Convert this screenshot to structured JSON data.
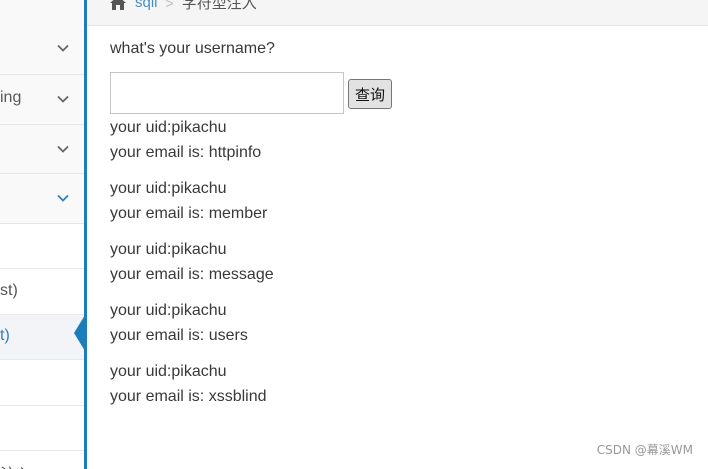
{
  "breadcrumb": {
    "link": "sqli",
    "current": "字符型注入"
  },
  "sidebar": {
    "items": [
      {
        "label": "",
        "expanded": false
      },
      {
        "label": "ing",
        "expanded": false
      },
      {
        "label": "",
        "expanded": false
      },
      {
        "label": "",
        "expanded": true
      }
    ],
    "subitems": [
      {
        "label": ""
      },
      {
        "label": "st)"
      },
      {
        "label": "t)",
        "active": true
      },
      {
        "label": ""
      },
      {
        "label": ""
      },
      {
        "label": "注入"
      }
    ]
  },
  "main": {
    "question": "what's your username?",
    "input_value": "",
    "submit_label": "查询",
    "results": [
      {
        "uid": "your uid:pikachu",
        "email": "your email is: httpinfo"
      },
      {
        "uid": "your uid:pikachu",
        "email": "your email is: member"
      },
      {
        "uid": "your uid:pikachu",
        "email": "your email is: message"
      },
      {
        "uid": "your uid:pikachu",
        "email": "your email is: users"
      },
      {
        "uid": "your uid:pikachu",
        "email": "your email is: xssblind"
      }
    ]
  },
  "watermark": "CSDN @幕溪WM",
  "colors": {
    "accent": "#1c7dbd",
    "link": "#4c8fbd"
  },
  "icons": {
    "home": "home-icon",
    "chevron": "chevron-down-icon"
  }
}
